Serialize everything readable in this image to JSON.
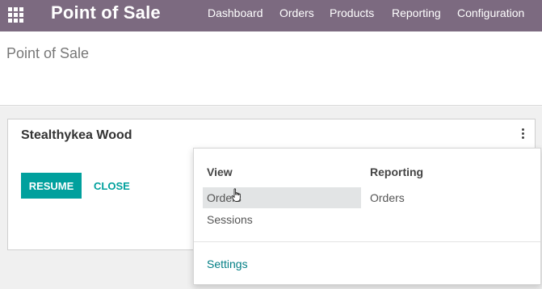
{
  "topbar": {
    "app_title": "Point of Sale",
    "menu": [
      "Dashboard",
      "Orders",
      "Products",
      "Reporting",
      "Configuration"
    ],
    "color": "#7c6a80"
  },
  "breadcrumb": "Point of Sale",
  "session_card": {
    "title": "Stealthykea Wood",
    "resume_label": "RESUME",
    "close_label": "CLOSE",
    "accent": "#00a09d"
  },
  "dropdown": {
    "view_heading": "View",
    "view_items": [
      "Orders",
      "Sessions"
    ],
    "reporting_heading": "Reporting",
    "reporting_items": [
      "Orders"
    ],
    "settings_label": "Settings"
  },
  "icons": [
    "apps-grid-icon",
    "kebab-menu-icon",
    "hand-cursor-icon"
  ]
}
